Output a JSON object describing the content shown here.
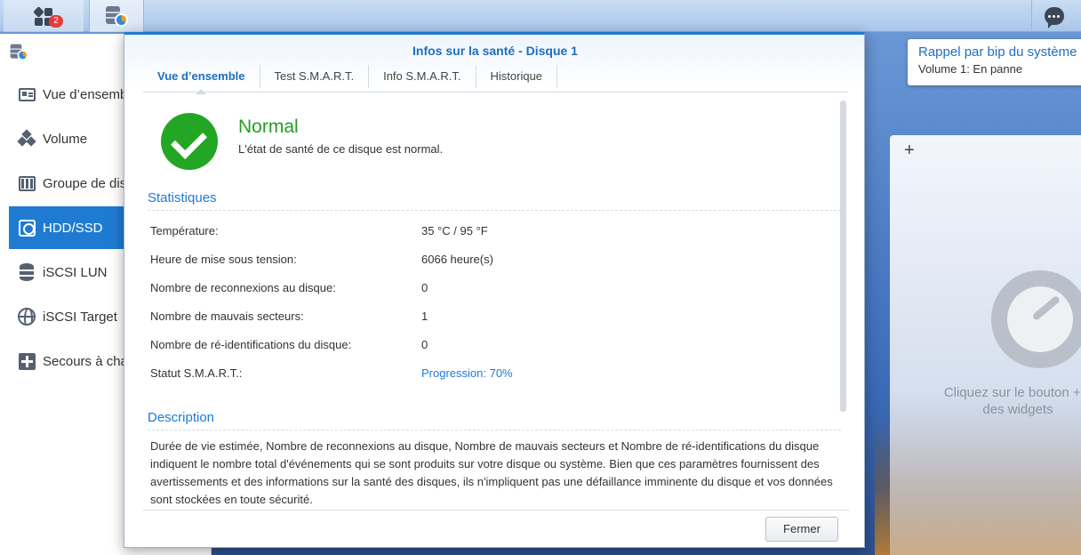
{
  "taskbar": {
    "main_menu_badge": "2"
  },
  "sidebar": {
    "items": [
      {
        "label": "Vue d’ensemble",
        "icon": "overview-card-icon"
      },
      {
        "label": "Volume",
        "icon": "volume-cubes-icon"
      },
      {
        "label": "Groupe de disques",
        "icon": "disk-group-icon"
      },
      {
        "label": "HDD/SSD",
        "icon": "hdd-icon",
        "active": true
      },
      {
        "label": "iSCSI LUN",
        "icon": "database-icon"
      },
      {
        "label": "iSCSI Target",
        "icon": "globe-icon"
      },
      {
        "label": "Secours à chaud",
        "icon": "plus-box-icon"
      }
    ]
  },
  "notification": {
    "title": "Rappel par bip du système",
    "message": "Volume 1: En panne"
  },
  "widgets": {
    "add_label": "+",
    "hint_line1": "Cliquez sur le bouton + p",
    "hint_line2": "des widgets"
  },
  "dialog": {
    "title": "Infos sur la santé - Disque 1",
    "tabs": [
      "Vue d’ensemble",
      "Test S.M.A.R.T.",
      "Info S.M.A.R.T.",
      "Historique"
    ],
    "status": {
      "title": "Normal",
      "subtitle": "L'état de santé de ce disque est normal.",
      "color": "#23a623"
    },
    "stats_heading": "Statistiques",
    "stats": [
      {
        "label": "Température:",
        "value": "35 °C / 95 °F"
      },
      {
        "label": "Heure de mise sous tension:",
        "value": "6066 heure(s)"
      },
      {
        "label": "Nombre de reconnexions au disque:",
        "value": "0"
      },
      {
        "label": "Nombre de mauvais secteurs:",
        "value": "1"
      },
      {
        "label": "Nombre de ré-identifications du disque:",
        "value": "0"
      },
      {
        "label": "Statut S.M.A.R.T.:",
        "value": "Progression: 70%"
      }
    ],
    "description_heading": "Description",
    "description": "Durée de vie estimée, Nombre de reconnexions au disque, Nombre de mauvais secteurs et Nombre de ré-identifications du disque indiquent le nombre total d'événements qui se sont produits sur votre disque ou système. Bien que ces paramètres fournissent des avertissements et des informations sur la santé des disques, ils n'impliquent pas une défaillance imminente du disque et vos données sont stockées en toute sécurité.",
    "close_label": "Fermer"
  },
  "colors": {
    "accent": "#1e7ad4",
    "active_nav": "#1f7bd1",
    "ok_green": "#23a623"
  }
}
